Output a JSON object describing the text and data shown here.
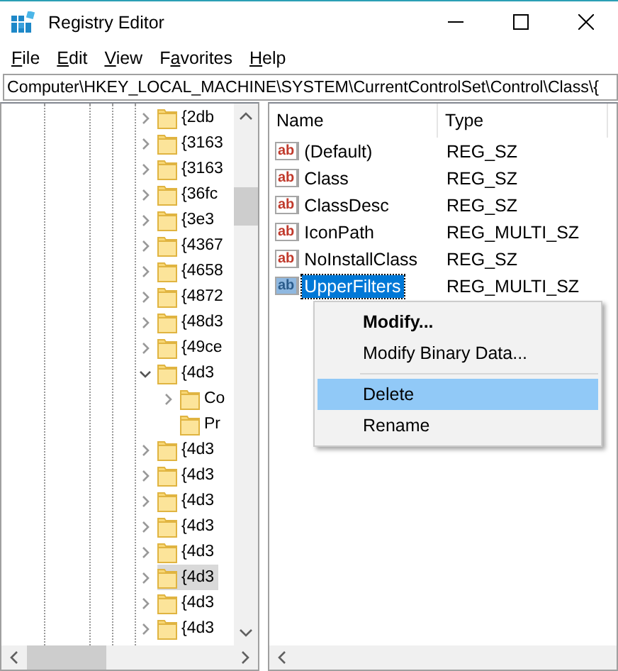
{
  "window": {
    "title": "Registry Editor"
  },
  "menu": [
    {
      "underlined": "F",
      "after": "ile"
    },
    {
      "underlined": "E",
      "after": "dit"
    },
    {
      "underlined": "V",
      "after": "iew"
    },
    {
      "before": "F",
      "underlined": "a",
      "after": "vorites"
    },
    {
      "underlined": "H",
      "after": "elp"
    }
  ],
  "address": "Computer\\HKEY_LOCAL_MACHINE\\SYSTEM\\CurrentControlSet\\Control\\Class\\{",
  "tree": [
    {
      "label": "{2db",
      "expandable": true,
      "expanded": false,
      "selected": false
    },
    {
      "label": "{3163",
      "expandable": true,
      "expanded": false,
      "selected": false
    },
    {
      "label": "{3163",
      "expandable": true,
      "expanded": false,
      "selected": false
    },
    {
      "label": "{36fc",
      "expandable": true,
      "expanded": false,
      "selected": false
    },
    {
      "label": "{3e3",
      "expandable": true,
      "expanded": false,
      "selected": false
    },
    {
      "label": "{4367",
      "expandable": true,
      "expanded": false,
      "selected": false
    },
    {
      "label": "{4658",
      "expandable": true,
      "expanded": false,
      "selected": false
    },
    {
      "label": "{4872",
      "expandable": true,
      "expanded": false,
      "selected": false
    },
    {
      "label": "{48d3",
      "expandable": true,
      "expanded": false,
      "selected": false
    },
    {
      "label": "{49ce",
      "expandable": true,
      "expanded": false,
      "selected": false
    },
    {
      "label": "{4d3",
      "expandable": true,
      "expanded": true,
      "selected": false,
      "children": [
        {
          "label": "Co",
          "expandable": true,
          "expanded": false,
          "selected": false
        },
        {
          "label": "Pr",
          "expandable": false,
          "expanded": false,
          "selected": false
        }
      ]
    },
    {
      "label": "{4d3",
      "expandable": true,
      "expanded": false,
      "selected": false
    },
    {
      "label": "{4d3",
      "expandable": true,
      "expanded": false,
      "selected": false
    },
    {
      "label": "{4d3",
      "expandable": true,
      "expanded": false,
      "selected": false
    },
    {
      "label": "{4d3",
      "expandable": true,
      "expanded": false,
      "selected": false
    },
    {
      "label": "{4d3",
      "expandable": true,
      "expanded": false,
      "selected": false
    },
    {
      "label": "{4d3",
      "expandable": true,
      "expanded": false,
      "selected": true
    },
    {
      "label": "{4d3",
      "expandable": true,
      "expanded": false,
      "selected": false
    },
    {
      "label": "{4d3",
      "expandable": true,
      "expanded": false,
      "selected": false
    }
  ],
  "values": {
    "columns": [
      "Name",
      "Type"
    ],
    "rows": [
      {
        "icon_text": "ab",
        "name": "(Default)",
        "type": "REG_SZ",
        "selected": false
      },
      {
        "icon_text": "ab",
        "name": "Class",
        "type": "REG_SZ",
        "selected": false
      },
      {
        "icon_text": "ab",
        "name": "ClassDesc",
        "type": "REG_SZ",
        "selected": false
      },
      {
        "icon_text": "ab",
        "name": "IconPath",
        "type": "REG_MULTI_SZ",
        "selected": false
      },
      {
        "icon_text": "ab",
        "name": "NoInstallClass",
        "type": "REG_SZ",
        "selected": false
      },
      {
        "icon_text": "ab",
        "name": "UpperFilters",
        "type": "REG_MULTI_SZ",
        "selected": true
      }
    ]
  },
  "context_menu": [
    {
      "kind": "item",
      "label": "Modify...",
      "default": true,
      "selected": false
    },
    {
      "kind": "item",
      "label": "Modify Binary Data...",
      "default": false,
      "selected": false
    },
    {
      "kind": "separator"
    },
    {
      "kind": "item",
      "label": "Delete",
      "default": false,
      "selected": true
    },
    {
      "kind": "item",
      "label": "Rename",
      "default": false,
      "selected": false
    }
  ]
}
